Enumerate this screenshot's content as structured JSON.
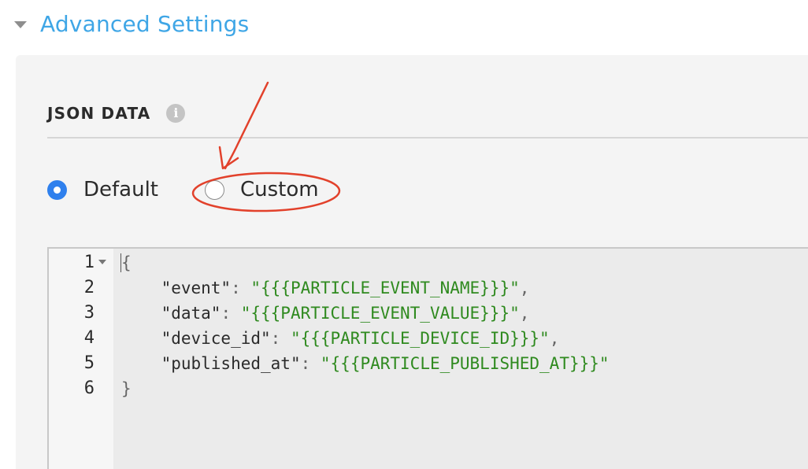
{
  "section": {
    "title": "Advanced Settings"
  },
  "json_data": {
    "label": "JSON DATA",
    "info_icon": "i"
  },
  "radio_options": [
    {
      "label": "Default",
      "selected": true
    },
    {
      "label": "Custom",
      "selected": false
    }
  ],
  "editor": {
    "line_numbers": [
      "1",
      "2",
      "3",
      "4",
      "5",
      "6"
    ],
    "lines": [
      {
        "open": "{"
      },
      {
        "key": "\"event\"",
        "colon": ": ",
        "value": "\"{{{PARTICLE_EVENT_NAME}}}\"",
        "comma": ","
      },
      {
        "key": "\"data\"",
        "colon": ": ",
        "value": "\"{{{PARTICLE_EVENT_VALUE}}}\"",
        "comma": ","
      },
      {
        "key": "\"device_id\"",
        "colon": ": ",
        "value": "\"{{{PARTICLE_DEVICE_ID}}}\"",
        "comma": ","
      },
      {
        "key": "\"published_at\"",
        "colon": ": ",
        "value": "\"{{{PARTICLE_PUBLISHED_AT}}}\"",
        "comma": ""
      },
      {
        "close": "}"
      }
    ]
  },
  "colors": {
    "accent": "#3fa6e6",
    "radio_checked": "#2f80ed",
    "annotation": "#e2412b",
    "json_string": "#2f8a1f"
  },
  "icons": {
    "collapse": "caret-down-icon",
    "info": "info-icon",
    "fold": "fold-down-icon"
  }
}
